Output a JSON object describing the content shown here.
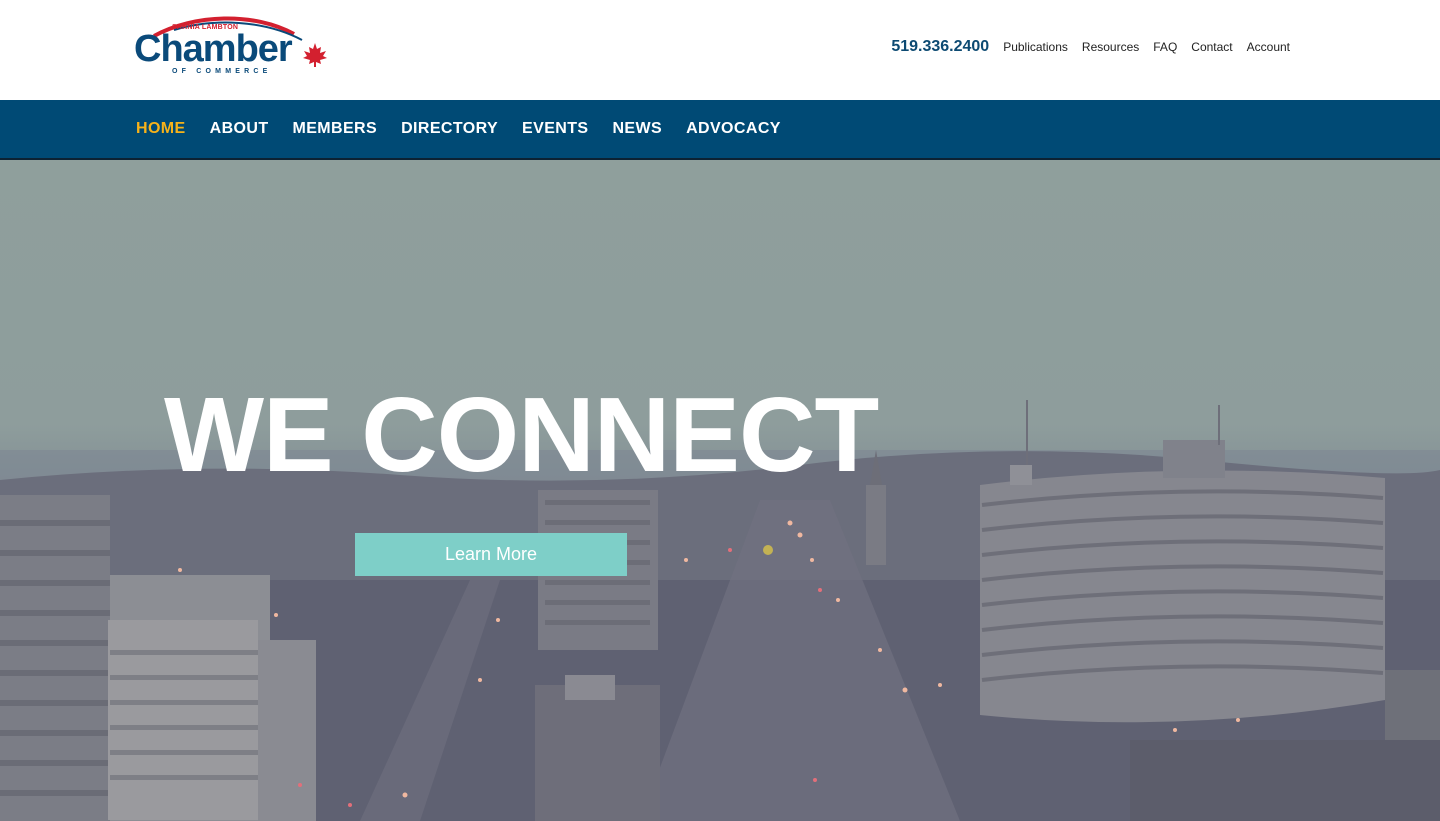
{
  "header": {
    "logo": {
      "top_text": "SARNIA LAMBTON",
      "main_text": "Chamber",
      "sub_text": "OF COMMERCE"
    },
    "phone": "519.336.2400",
    "utility_links": [
      "Publications",
      "Resources",
      "FAQ",
      "Contact",
      "Account"
    ]
  },
  "nav": {
    "items": [
      "HOME",
      "ABOUT",
      "MEMBERS",
      "DIRECTORY",
      "EVENTS",
      "NEWS",
      "ADVOCACY"
    ],
    "active": "HOME"
  },
  "hero": {
    "headline": "WE CONNECT",
    "cta_label": "Learn More"
  },
  "colors": {
    "nav_bg": "#004a75",
    "nav_active": "#f6b21a",
    "cta_bg": "#7ecfc8",
    "brand_blue": "#0a4a7a",
    "brand_red": "#d3202f"
  }
}
